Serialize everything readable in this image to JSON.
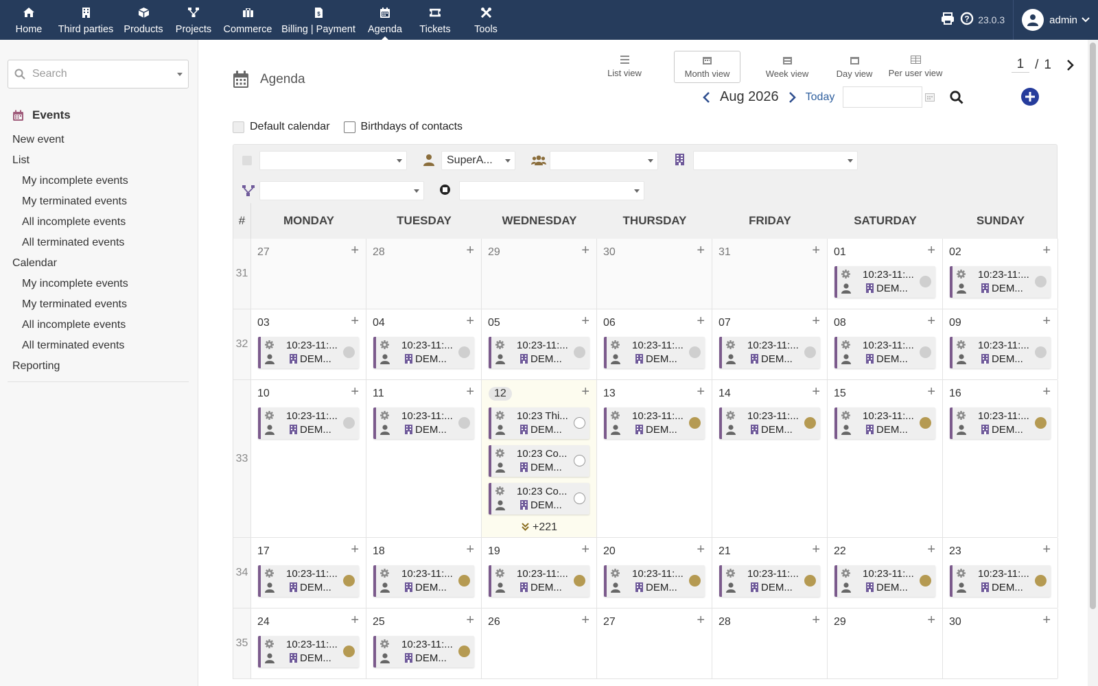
{
  "nav": {
    "items": [
      {
        "label": "Home",
        "icon": "home-icon"
      },
      {
        "label": "Third parties",
        "icon": "building-icon"
      },
      {
        "label": "Products",
        "icon": "cube-icon"
      },
      {
        "label": "Projects",
        "icon": "project-icon"
      },
      {
        "label": "Commerce",
        "icon": "briefcase-icon"
      },
      {
        "label": "Billing | Payment",
        "icon": "invoice-icon"
      },
      {
        "label": "Agenda",
        "icon": "calendar-icon",
        "active": true
      },
      {
        "label": "Tickets",
        "icon": "ticket-icon"
      },
      {
        "label": "Tools",
        "icon": "tools-icon"
      }
    ],
    "version": "23.0.3",
    "username": "admin"
  },
  "sidebar": {
    "search_placeholder": "Search",
    "title": "Events",
    "links": [
      {
        "label": "New event",
        "level": 0
      },
      {
        "label": "List",
        "level": 0
      },
      {
        "label": "My incomplete events",
        "level": 1
      },
      {
        "label": "My terminated events",
        "level": 1
      },
      {
        "label": "All incomplete events",
        "level": 1
      },
      {
        "label": "All terminated events",
        "level": 1
      },
      {
        "label": "Calendar",
        "level": 0
      },
      {
        "label": "My incomplete events",
        "level": 1
      },
      {
        "label": "My terminated events",
        "level": 1
      },
      {
        "label": "All incomplete events",
        "level": 1
      },
      {
        "label": "All terminated events",
        "level": 1
      },
      {
        "label": "Reporting",
        "level": 0
      }
    ]
  },
  "main": {
    "title": "Agenda",
    "views": [
      {
        "label": "List view",
        "active": false
      },
      {
        "label": "Month view",
        "active": true
      },
      {
        "label": "Week view",
        "active": false
      },
      {
        "label": "Day view",
        "active": false
      },
      {
        "label": "Per user view",
        "active": false
      }
    ],
    "pager": {
      "current": "1",
      "sep": "/",
      "total": "1"
    },
    "month_label": "Aug 2026",
    "today_label": "Today",
    "checks": {
      "default_calendar": "Default calendar",
      "birthdays": "Birthdays of contacts"
    },
    "filters": {
      "user_value": "SuperA..."
    }
  },
  "colors": {
    "nav_bg": "#263c5c",
    "event_border": "#7b5a8c",
    "dot_grey": "#cfcfcf",
    "dot_gold": "#b59a52"
  },
  "calendar": {
    "hash": "#",
    "days": [
      "MONDAY",
      "TUESDAY",
      "WEDNESDAY",
      "THURSDAY",
      "FRIDAY",
      "SATURDAY",
      "SUNDAY"
    ],
    "weeks": [
      {
        "num": "31",
        "cells": [
          {
            "d": "27",
            "other": true,
            "events": []
          },
          {
            "d": "28",
            "other": true,
            "events": []
          },
          {
            "d": "29",
            "other": true,
            "events": []
          },
          {
            "d": "30",
            "other": true,
            "events": []
          },
          {
            "d": "31",
            "other": true,
            "events": []
          },
          {
            "d": "01",
            "events": [
              {
                "t": "10:23-11:...",
                "c": "DEM...",
                "s": "grey"
              }
            ]
          },
          {
            "d": "02",
            "events": [
              {
                "t": "10:23-11:...",
                "c": "DEM...",
                "s": "grey"
              }
            ]
          }
        ]
      },
      {
        "num": "32",
        "cells": [
          {
            "d": "03",
            "events": [
              {
                "t": "10:23-11:...",
                "c": "DEM...",
                "s": "grey"
              }
            ]
          },
          {
            "d": "04",
            "events": [
              {
                "t": "10:23-11:...",
                "c": "DEM...",
                "s": "grey"
              }
            ]
          },
          {
            "d": "05",
            "events": [
              {
                "t": "10:23-11:...",
                "c": "DEM...",
                "s": "grey"
              }
            ]
          },
          {
            "d": "06",
            "events": [
              {
                "t": "10:23-11:...",
                "c": "DEM...",
                "s": "grey"
              }
            ]
          },
          {
            "d": "07",
            "events": [
              {
                "t": "10:23-11:...",
                "c": "DEM...",
                "s": "grey"
              }
            ]
          },
          {
            "d": "08",
            "events": [
              {
                "t": "10:23-11:...",
                "c": "DEM...",
                "s": "grey"
              }
            ]
          },
          {
            "d": "09",
            "events": [
              {
                "t": "10:23-11:...",
                "c": "DEM...",
                "s": "grey"
              }
            ]
          }
        ]
      },
      {
        "num": "33",
        "cells": [
          {
            "d": "10",
            "events": [
              {
                "t": "10:23-11:...",
                "c": "DEM...",
                "s": "grey"
              }
            ]
          },
          {
            "d": "11",
            "events": [
              {
                "t": "10:23-11:...",
                "c": "DEM...",
                "s": "grey"
              }
            ]
          },
          {
            "d": "12",
            "today": true,
            "more": "+221",
            "events": [
              {
                "t": "10:23 Thi...",
                "c": "DEM...",
                "s": "empty"
              },
              {
                "t": "10:23 Co...",
                "c": "DEM...",
                "s": "empty"
              },
              {
                "t": "10:23 Co...",
                "c": "DEM...",
                "s": "empty"
              }
            ]
          },
          {
            "d": "13",
            "events": [
              {
                "t": "10:23-11:...",
                "c": "DEM...",
                "s": "gold"
              }
            ]
          },
          {
            "d": "14",
            "events": [
              {
                "t": "10:23-11:...",
                "c": "DEM...",
                "s": "gold"
              }
            ]
          },
          {
            "d": "15",
            "events": [
              {
                "t": "10:23-11:...",
                "c": "DEM...",
                "s": "gold"
              }
            ]
          },
          {
            "d": "16",
            "events": [
              {
                "t": "10:23-11:...",
                "c": "DEM...",
                "s": "gold"
              }
            ]
          }
        ]
      },
      {
        "num": "34",
        "cells": [
          {
            "d": "17",
            "events": [
              {
                "t": "10:23-11:...",
                "c": "DEM...",
                "s": "gold"
              }
            ]
          },
          {
            "d": "18",
            "events": [
              {
                "t": "10:23-11:...",
                "c": "DEM...",
                "s": "gold"
              }
            ]
          },
          {
            "d": "19",
            "events": [
              {
                "t": "10:23-11:...",
                "c": "DEM...",
                "s": "gold"
              }
            ]
          },
          {
            "d": "20",
            "events": [
              {
                "t": "10:23-11:...",
                "c": "DEM...",
                "s": "gold"
              }
            ]
          },
          {
            "d": "21",
            "events": [
              {
                "t": "10:23-11:...",
                "c": "DEM...",
                "s": "gold"
              }
            ]
          },
          {
            "d": "22",
            "events": [
              {
                "t": "10:23-11:...",
                "c": "DEM...",
                "s": "gold"
              }
            ]
          },
          {
            "d": "23",
            "events": [
              {
                "t": "10:23-11:...",
                "c": "DEM...",
                "s": "gold"
              }
            ]
          }
        ]
      },
      {
        "num": "35",
        "cells": [
          {
            "d": "24",
            "events": [
              {
                "t": "10:23-11:...",
                "c": "DEM...",
                "s": "gold"
              }
            ]
          },
          {
            "d": "25",
            "events": [
              {
                "t": "10:23-11:...",
                "c": "DEM...",
                "s": "gold"
              }
            ]
          },
          {
            "d": "26",
            "events": []
          },
          {
            "d": "27",
            "events": []
          },
          {
            "d": "28",
            "events": []
          },
          {
            "d": "29",
            "events": []
          },
          {
            "d": "30",
            "events": []
          }
        ]
      }
    ]
  }
}
